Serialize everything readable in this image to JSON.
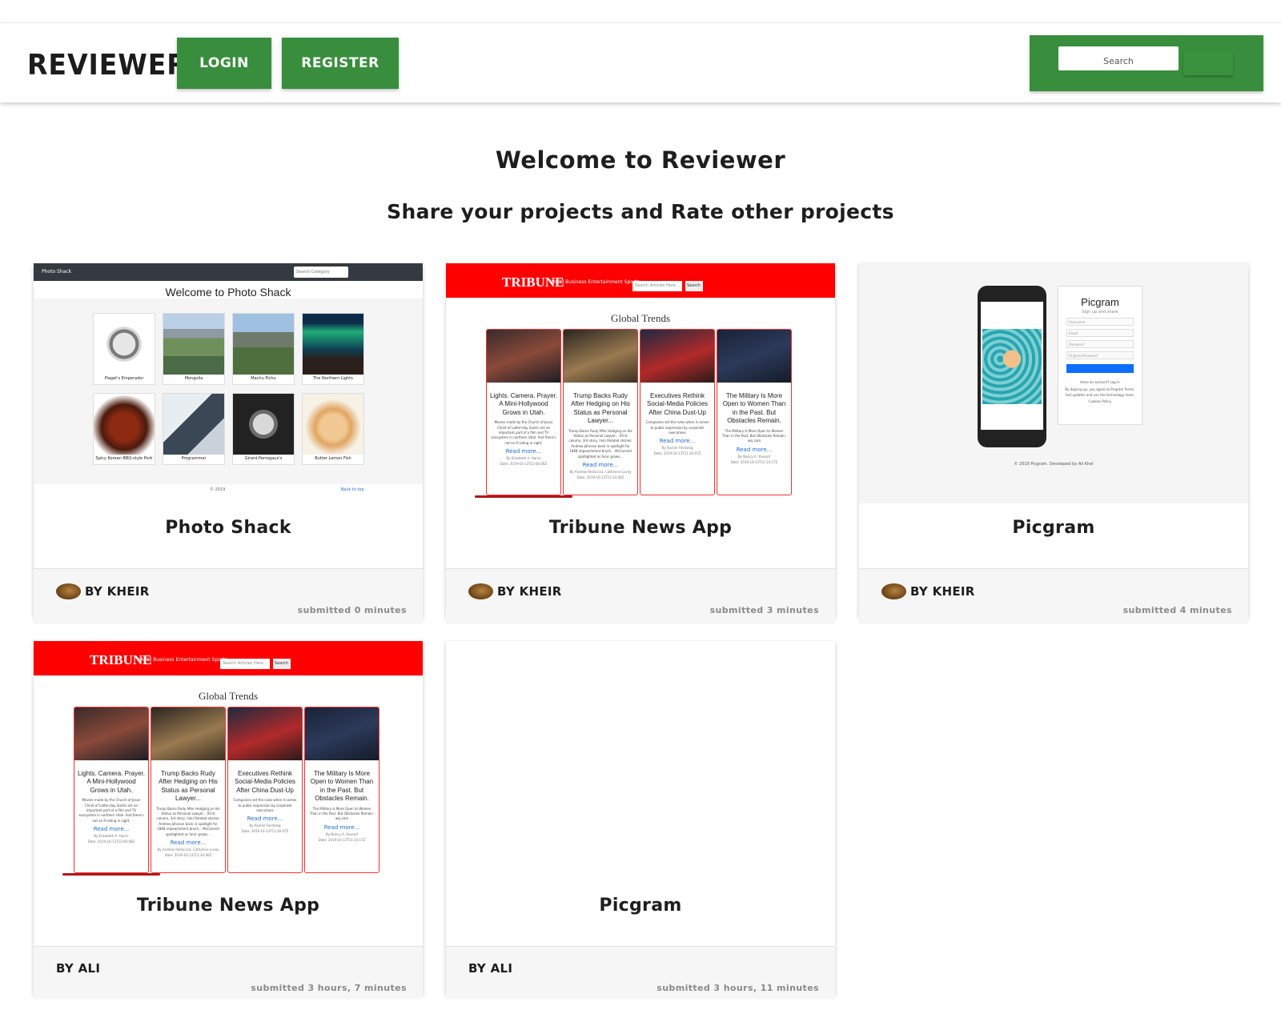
{
  "header": {
    "brand": "REVIEWER",
    "login_label": "LOGIN",
    "register_label": "REGISTER",
    "search_placeholder": "Search"
  },
  "hero": {
    "title": "Welcome to Reviewer",
    "subtitle": "Share your projects and Rate other projects"
  },
  "colors": {
    "accent": "#388e3c",
    "tribune_red": "#ff0000"
  },
  "projects": [
    {
      "title": "Photo Shack",
      "author": "BY KHEIR",
      "submitted": "submitted 0 minutes",
      "has_avatar": true
    },
    {
      "title": "Tribune News App",
      "author": "BY KHEIR",
      "submitted": "submitted 3 minutes",
      "has_avatar": true
    },
    {
      "title": "Picgram",
      "author": "BY KHEIR",
      "submitted": "submitted 4 minutes",
      "has_avatar": true
    },
    {
      "title": "Tribune News App",
      "author": "BY ALI",
      "submitted": "submitted 3 hours, 7 minutes",
      "has_avatar": false
    },
    {
      "title": "Picgram",
      "author": "BY ALI",
      "submitted": "submitted 3 hours, 11 minutes",
      "has_avatar": false
    }
  ],
  "previews": {
    "photo_shack": {
      "brand": "Photo Shack",
      "search": "Search Category",
      "title": "Welcome to Photo Shack",
      "captions": [
        "Piaget's Emperador",
        "Mongolia",
        "Machu Pichu",
        "The Northern Lights",
        "Spicy Korean BBQ-style Pork",
        "Programmer",
        "Girard-Perregaux's",
        "Butter Lemon Fish"
      ],
      "footer_left": "© 2019",
      "footer_right": "Back to top"
    },
    "tribune": {
      "logo": "TRIBUNE",
      "nav": "World  Business  Entertainment  Sports",
      "search": "Search Articles Here...",
      "search_btn": "Search",
      "heading": "Global Trends",
      "articles": [
        {
          "title": "Lights. Camera. Prayer. A Mini-Hollywood Grows in Utah.",
          "text": "Movies made by the Church of Jesus Christ of Latter-day Saints are an important part of a film and TV ecosystem in northern Utah. And there's not an R-rating in sight.",
          "more": "Read more...",
          "by": "By Elizabeth A. Harris",
          "date": "Date: 2019-10-13T12:00:06Z"
        },
        {
          "title": "Trump Backs Rudy After Hedging on His Status as Personal Lawyer...",
          "text": "Trump Backs Rudy After Hedging on His Status as Personal Lawyer... (First column, 3rd story, link) Related stories: Andrew Johnson back in spotlight for 1868 impeachment brush... McConnell spotlighted as furor grows...",
          "more": "Read more...",
          "by": "By Andrew Restuccia, Catherine Lucey",
          "date": "Date: 2019-10-13T11:34:40Z"
        },
        {
          "title": "Executives Rethink Social-Media Policies After China Dust-Up",
          "text": "Companies set the rules when it comes to public expression by corporate executives",
          "more": "Read more...",
          "by": "By Rachel Feintzeig",
          "date": "Date: 2019-10-13T11:30:07Z"
        },
        {
          "title": "The Military Is More Open to Women Than in the Past. But Obstacles Remain.",
          "text": "The Military Is More Open to Women Than in the Past. But Obstacles Remain. wsj.com",
          "more": "Read more...",
          "by": "By Nancy A. Youssef",
          "date": "Date: 2019-10-13T11:14:17Z"
        }
      ]
    },
    "picgram": {
      "title": "Picgram",
      "subtitle": "Sign up and share",
      "fields": [
        "Username",
        "Email",
        "Password",
        "Original Password"
      ],
      "login_prompt": "Have an account? Log in",
      "terms": "By Signing up, you agree to Picgram Terms. Get updates and use the technology more. Cookies Policy.",
      "footer": "© 2019 Picgram. Developed by Ali Khel"
    }
  }
}
